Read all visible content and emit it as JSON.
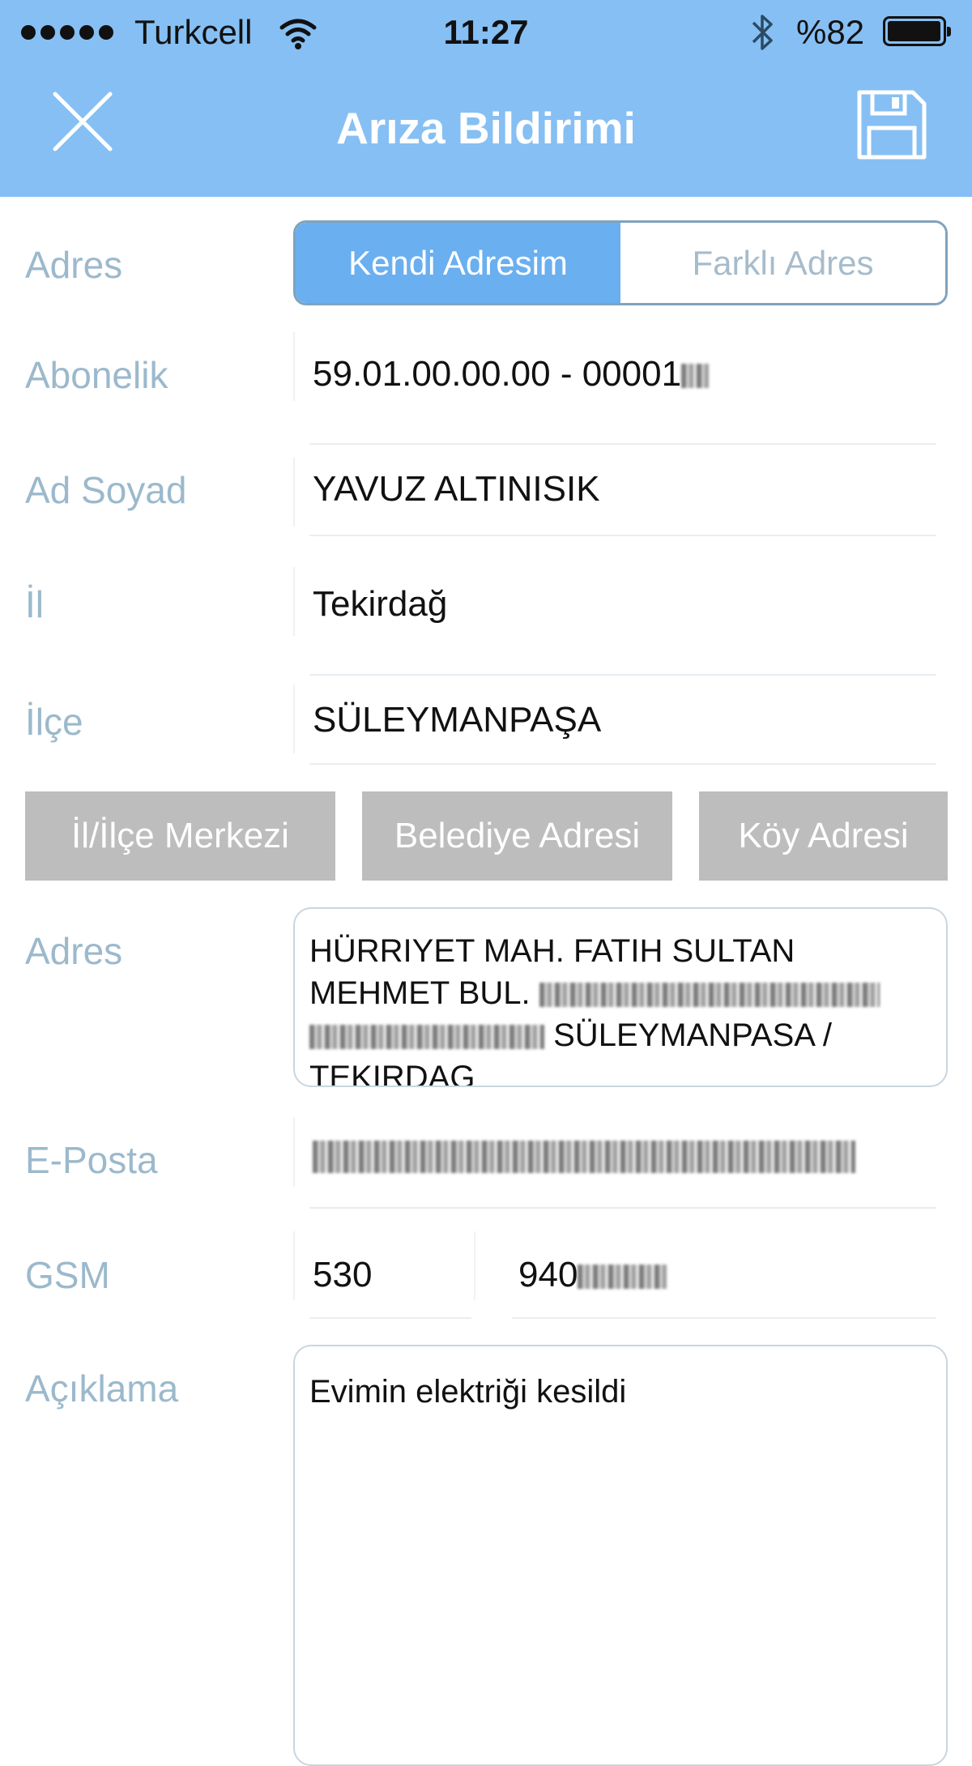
{
  "status_bar": {
    "carrier": "Turkcell",
    "time": "11:27",
    "battery_percent": "%82",
    "battery_level": 0.82,
    "icons": [
      "signal-dots-icon",
      "wifi-icon",
      "bluetooth-icon",
      "battery-icon"
    ]
  },
  "nav": {
    "title": "Arıza Bildirimi",
    "close_icon": "close-icon",
    "save_icon": "save-icon"
  },
  "colors": {
    "header_bg": "#86bff3",
    "accent": "#6aaff0",
    "label": "#9cb9cc",
    "button_grey": "#bdbdbd"
  },
  "form": {
    "address_label": "Adres",
    "address_options": [
      "Kendi Adresim",
      "Farklı Adres"
    ],
    "address_selected": "Kendi Adresim",
    "subscription_label": "Abonelik",
    "subscription_value": "59.01.00.00.00 - 00001",
    "name_label": "Ad Soyad",
    "name_value": "YAVUZ ALTINISIK",
    "city_label": "İl",
    "city_value": "Tekirdağ",
    "district_label": "İlçe",
    "district_value": "SÜLEYMANPAŞA",
    "address_type_buttons": [
      "İl/İlçe Merkezi",
      "Belediye Adresi",
      "Köy Adresi"
    ],
    "full_address_label": "Adres",
    "full_address_line1": "HÜRRIYET MAH. FATIH SULTAN",
    "full_address_line2": "MEHMET BUL.",
    "full_address_line3": "SÜLEYMANPASA /",
    "full_address_line4": "TEKIRDAG",
    "email_label": "E-Posta",
    "gsm_label": "GSM",
    "gsm_prefix": "530",
    "gsm_number": "940",
    "description_label": "Açıklama",
    "description_value": "Evimin elektriği kesildi"
  }
}
